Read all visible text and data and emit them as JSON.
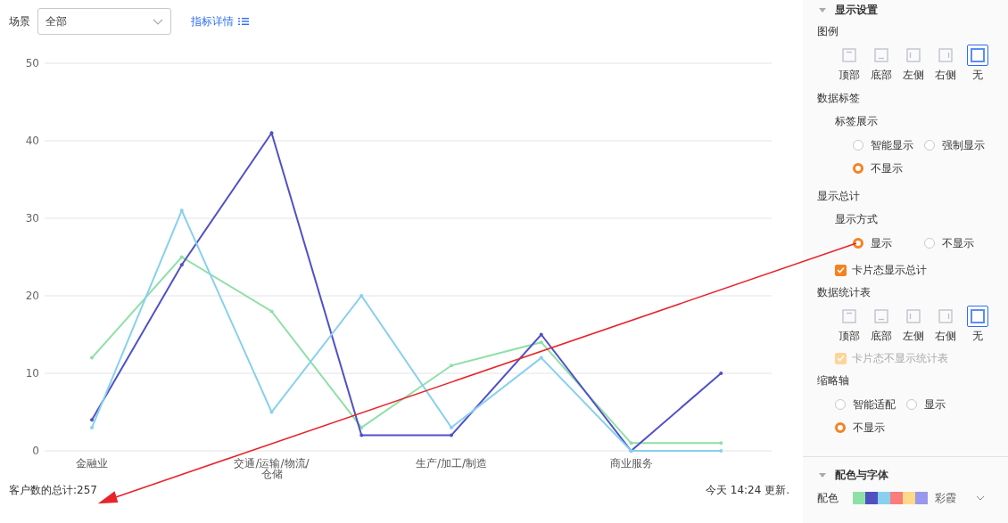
{
  "toolbar": {
    "scene_label": "场景",
    "scene_select": {
      "value": "全部"
    },
    "detail_link": "指标详情"
  },
  "chart": {
    "chart_data": {
      "type": "line",
      "categories": [
        "金融业",
        null,
        "交通/运输/物流/仓储",
        null,
        "生产/加工/制造",
        null,
        "商业服务",
        null
      ],
      "grid": true,
      "ylim": [
        0,
        50
      ],
      "yticks": [
        0,
        10,
        20,
        30,
        40,
        50
      ],
      "series": [
        {
          "color": "#8ee0a6",
          "values": [
            12,
            25,
            18,
            3,
            11,
            14,
            1,
            1
          ]
        },
        {
          "color": "#5050c8",
          "values": [
            4,
            24,
            41,
            2,
            2,
            15,
            0,
            10
          ]
        },
        {
          "color": "#88d0ee",
          "values": [
            3,
            31,
            5,
            20,
            3,
            12,
            0,
            0
          ]
        }
      ]
    }
  },
  "footer": {
    "total": "客户数的总计:257",
    "updated": "今天 14:24 更新."
  },
  "annotation": {
    "kind": "arrow",
    "color": "#e8242a"
  },
  "panel": {
    "sections": [
      {
        "title": "显示设置",
        "expanded": true,
        "items": [
          {
            "kind": "group",
            "title": "图例",
            "children": [
              {
                "kind": "positions",
                "options": [
                  {
                    "kind": "top",
                    "label": "顶部",
                    "selected": false
                  },
                  {
                    "kind": "bottom",
                    "label": "底部",
                    "selected": false
                  },
                  {
                    "kind": "left",
                    "label": "左侧",
                    "selected": false
                  },
                  {
                    "kind": "right",
                    "label": "右侧",
                    "selected": false
                  },
                  {
                    "kind": "none",
                    "label": "无",
                    "selected": true
                  }
                ]
              }
            ]
          },
          {
            "kind": "group",
            "title": "数据标签",
            "children": [
              {
                "kind": "group",
                "title": "标签展示",
                "children": [
                  {
                    "kind": "radios",
                    "options": [
                      {
                        "label": "智能显示",
                        "selected": false
                      },
                      {
                        "label": "强制显示",
                        "selected": false
                      },
                      {
                        "label": "不显示",
                        "selected": true
                      }
                    ]
                  }
                ]
              }
            ]
          },
          {
            "kind": "group",
            "title": "显示总计",
            "children": [
              {
                "kind": "group",
                "title": "显示方式",
                "children": [
                  {
                    "kind": "radios",
                    "options": [
                      {
                        "label": "显示",
                        "selected": true
                      },
                      {
                        "label": "不显示",
                        "selected": false
                      }
                    ]
                  }
                ]
              },
              {
                "kind": "checkbox",
                "label": "卡片态显示总计",
                "checked": true,
                "disabled": false
              }
            ]
          },
          {
            "kind": "group",
            "title": "数据统计表",
            "children": [
              {
                "kind": "positions",
                "options": [
                  {
                    "kind": "top",
                    "label": "顶部",
                    "selected": false
                  },
                  {
                    "kind": "bottom",
                    "label": "底部",
                    "selected": false
                  },
                  {
                    "kind": "left",
                    "label": "左侧",
                    "selected": false
                  },
                  {
                    "kind": "right",
                    "label": "右侧",
                    "selected": false
                  },
                  {
                    "kind": "none",
                    "label": "无",
                    "selected": true
                  }
                ]
              },
              {
                "kind": "checkbox",
                "label": "卡片态不显示统计表",
                "checked": true,
                "disabled": true
              }
            ]
          },
          {
            "kind": "group",
            "title": "缩略轴",
            "children": [
              {
                "kind": "radios",
                "options": [
                  {
                    "label": "智能适配",
                    "selected": false
                  },
                  {
                    "label": "显示",
                    "selected": false
                  },
                  {
                    "label": "不显示",
                    "selected": true
                  }
                ]
              }
            ]
          }
        ]
      },
      {
        "title": "配色与字体",
        "expanded": true,
        "items": [
          {
            "kind": "palette",
            "label": "配色",
            "value": "彩霞",
            "swatches": [
              {
                "color": "#8ee0a6"
              },
              {
                "color": "#5050c0"
              },
              {
                "color": "#88d0ee"
              },
              {
                "color": "#fa7c7c"
              },
              {
                "color": "#ffd98a"
              },
              {
                "color": "#9898ee"
              }
            ]
          }
        ]
      }
    ]
  }
}
